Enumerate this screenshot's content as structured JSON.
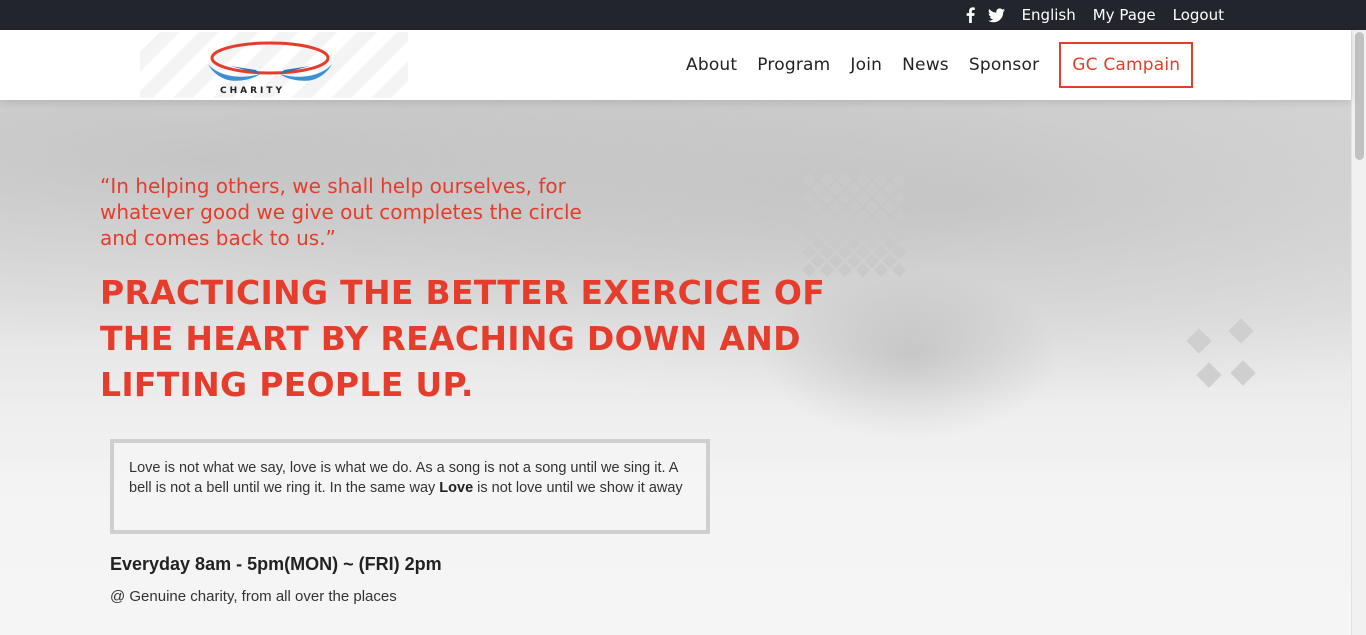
{
  "topbar": {
    "icons": [
      "facebook-icon",
      "twitter-icon"
    ],
    "links": [
      "English",
      "My Page",
      "Logout"
    ]
  },
  "logo": {
    "text": "CHARITY"
  },
  "nav": {
    "items": [
      "About",
      "Program",
      "Join",
      "News",
      "Sponsor"
    ],
    "cta": "GC Campain"
  },
  "hero": {
    "quote_line1": "“In helping others, we shall help ourselves, for",
    "quote_line2": "whatever good we give out completes the circle",
    "quote_line3": "and comes back to us.”",
    "headline": "PRACTICING THE BETTER EXERCICE OF THE HEART BY REACHING DOWN AND LIFTING PEOPLE UP.",
    "love_text_1": "Love is not what we say, love is what we do. As a song is not a song until we sing it. A bell is not a bell until we ring it. In the same way ",
    "love_bold": "Love",
    "love_text_2": " is not love until we show it away",
    "hours": "Everyday 8am - 5pm(MON) ~ (FRI) 2pm",
    "place": "@ Genuine charity, from all over the places"
  },
  "colors": {
    "accent": "#e63c2b",
    "topbar": "#23252c",
    "logo_blue": "#3a8fd6"
  }
}
